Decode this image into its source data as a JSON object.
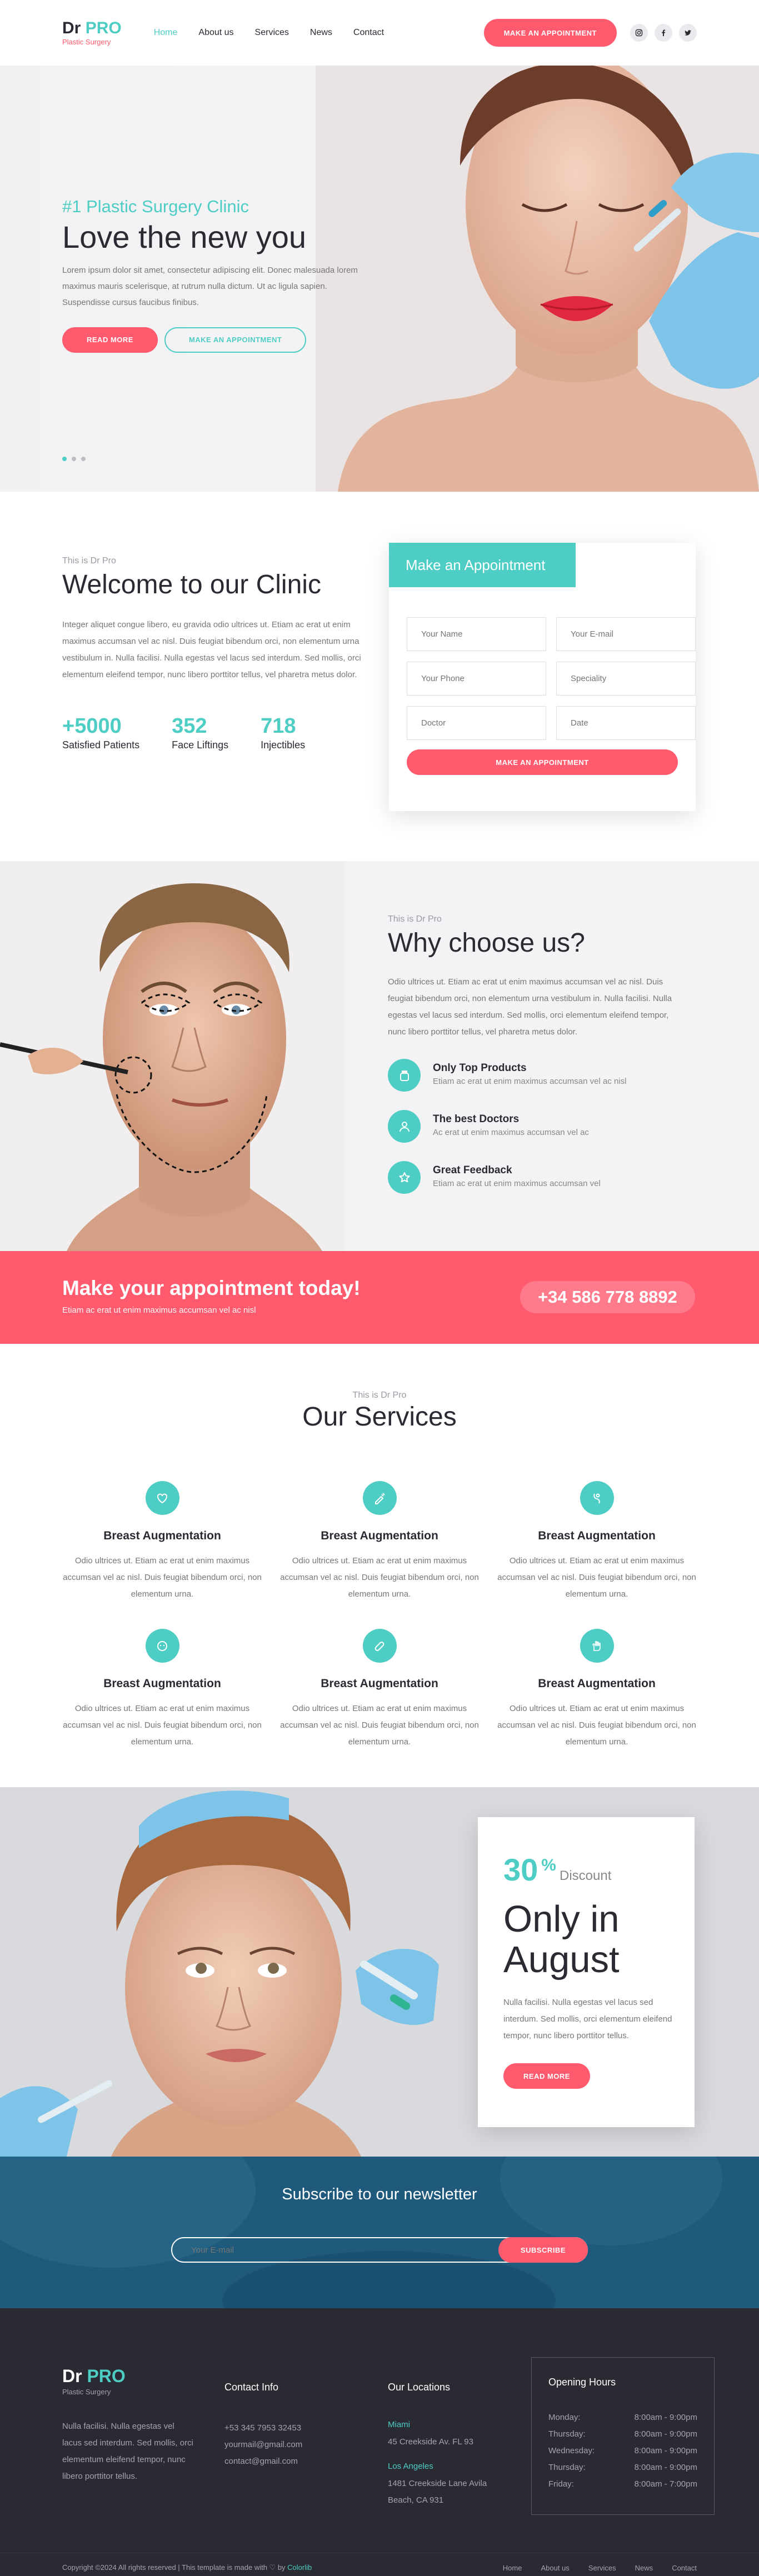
{
  "header": {
    "logo_main": "Dr ",
    "logo_accent": "PRO",
    "logo_sub": "Plastic Surgery",
    "nav": [
      "Home",
      "About us",
      "Services",
      "News",
      "Contact"
    ],
    "cta": "MAKE AN APPOINTMENT",
    "social_icons": [
      "instagram-icon",
      "facebook-icon",
      "twitter-icon"
    ]
  },
  "hero": {
    "kicker": "#1 Plastic Surgery Clinic",
    "title": "Love the new you",
    "desc": "Lorem ipsum dolor sit amet, consectetur adipiscing elit. Donec malesuada lorem maximus mauris scelerisque, at rutrum nulla dictum. Ut ac ligula sapien. Suspendisse cursus faucibus finibus.",
    "btn_read": "READ MORE",
    "btn_appt": "MAKE AN APPOINTMENT"
  },
  "welcome": {
    "eyebrow": "This is Dr Pro",
    "title": "Welcome to our Clinic",
    "desc": "Integer aliquet congue libero, eu gravida odio ultrices ut. Etiam ac erat ut enim maximus accumsan vel ac nisl. Duis feugiat bibendum orci, non elementum urna vestibulum in. Nulla facilisi. Nulla egestas vel lacus sed interdum. Sed mollis, orci elementum eleifend tempor, nunc libero porttitor tellus, vel pharetra metus dolor.",
    "stats": [
      {
        "num": "+5000",
        "label": "Satisfied Patients"
      },
      {
        "num": "352",
        "label": "Face Liftings"
      },
      {
        "num": "718",
        "label": "Injectibles"
      }
    ],
    "form": {
      "tab": "Make an Appointment",
      "placeholders": [
        "Your Name",
        "Your E-mail",
        "Your Phone",
        "Speciality",
        "Doctor",
        "Date"
      ],
      "submit": "MAKE AN APPOINTMENT"
    }
  },
  "why": {
    "eyebrow": "This is Dr Pro",
    "title": "Why choose us?",
    "desc": "Odio ultrices ut. Etiam ac erat ut enim maximus accumsan vel ac nisl. Duis feugiat bibendum orci, non elementum urna vestibulum in. Nulla facilisi. Nulla egestas vel lacus sed interdum. Sed mollis, orci elementum eleifend tempor, nunc libero porttitor tellus, vel pharetra metus dolor.",
    "features": [
      {
        "title": "Only Top Products",
        "desc": "Etiam ac erat ut enim maximus accumsan vel ac nisl"
      },
      {
        "title": "The best Doctors",
        "desc": "Ac erat ut enim maximus accumsan vel ac"
      },
      {
        "title": "Great Feedback",
        "desc": "Etiam ac erat ut enim maximus accumsan vel"
      }
    ]
  },
  "cta": {
    "title": "Make your appointment today!",
    "sub": "Etiam ac erat ut enim maximus accumsan vel ac nisl",
    "phone": "+34 586 778 8892"
  },
  "services": {
    "eyebrow": "This is Dr Pro",
    "title": "Our Services",
    "items": [
      {
        "title": "Breast Augmentation",
        "desc": "Odio ultrices ut. Etiam ac erat ut enim maximus accumsan vel ac nisl. Duis feugiat bibendum orci, non elementum urna."
      },
      {
        "title": "Breast Augmentation",
        "desc": "Odio ultrices ut. Etiam ac erat ut enim maximus accumsan vel ac nisl. Duis feugiat bibendum orci, non elementum urna."
      },
      {
        "title": "Breast Augmentation",
        "desc": "Odio ultrices ut. Etiam ac erat ut enim maximus accumsan vel ac nisl. Duis feugiat bibendum orci, non elementum urna."
      },
      {
        "title": "Breast Augmentation",
        "desc": "Odio ultrices ut. Etiam ac erat ut enim maximus accumsan vel ac nisl. Duis feugiat bibendum orci, non elementum urna."
      },
      {
        "title": "Breast Augmentation",
        "desc": "Odio ultrices ut. Etiam ac erat ut enim maximus accumsan vel ac nisl. Duis feugiat bibendum orci, non elementum urna."
      },
      {
        "title": "Breast Augmentation",
        "desc": "Odio ultrices ut. Etiam ac erat ut enim maximus accumsan vel ac nisl. Duis feugiat bibendum orci, non elementum urna."
      }
    ]
  },
  "promo": {
    "pct": "30",
    "pct_sym": "%",
    "pct_label": "Discount",
    "title": "Only in August",
    "desc": "Nulla facilisi. Nulla egestas vel lacus sed interdum. Sed mollis, orci elementum eleifend tempor, nunc libero porttitor tellus.",
    "btn": "READ MORE"
  },
  "newsletter": {
    "title": "Subscribe to our newsletter",
    "placeholder": "Your E-mail",
    "btn": "SUBSCRIBE"
  },
  "footer": {
    "logo_main": "Dr ",
    "logo_accent": "PRO",
    "logo_sub": "Plastic Surgery",
    "about": "Nulla facilisi. Nulla egestas vel lacus sed interdum. Sed mollis, orci elementum eleifend tempor, nunc libero porttitor tellus.",
    "contact_title": "Contact Info",
    "contact": [
      "+53 345 7953 32453",
      "yourmail@gmail.com",
      "contact@gmail.com"
    ],
    "locations_title": "Our Locations",
    "locations": [
      {
        "city": "Miami",
        "address": "45 Creekside Av. FL 93"
      },
      {
        "city": "Los Angeles",
        "address": "1481 Creekside Lane Avila Beach, CA 931"
      }
    ],
    "hours_title": "Opening Hours",
    "hours": [
      {
        "day": "Monday:",
        "time": "8:00am - 9:00pm"
      },
      {
        "day": "Thursday:",
        "time": "8:00am - 9:00pm"
      },
      {
        "day": "Wednesday:",
        "time": "8:00am - 9:00pm"
      },
      {
        "day": "Thursday:",
        "time": "8:00am - 9:00pm"
      },
      {
        "day": "Friday:",
        "time": "8:00am - 7:00pm"
      }
    ],
    "copyright": "Copyright ©2024 All rights reserved | This template is made with ♡ by ",
    "credit": "Colorlib",
    "links": [
      "Home",
      "About us",
      "Services",
      "News",
      "Contact"
    ]
  },
  "colors": {
    "teal": "#4ecdc4",
    "pink": "#ff5a6e",
    "dark": "#2a2a33",
    "navy": "#1f5a7c"
  }
}
